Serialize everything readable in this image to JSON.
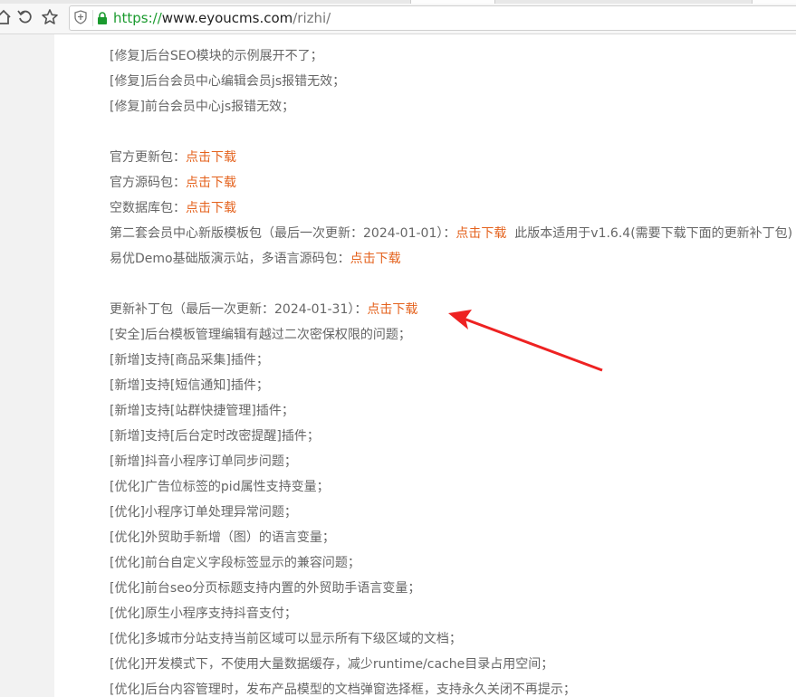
{
  "browser": {
    "url_scheme": "https://",
    "url_host": "www.eyoucms.com",
    "url_path": "/rizhi/"
  },
  "download_label": "点击下载",
  "log_lines_top": [
    "[修复]后台SEO模块的示例展开不了；",
    "[修复]后台会员中心编辑会员js报错无效；",
    "[修复]前台会员中心js报错无效；"
  ],
  "packages": {
    "official_update": "官方更新包：",
    "official_source": "官方源码包：",
    "empty_db": "空数据库包：",
    "member_template": "第二套会员中心新版模板包（最后一次更新：2024-01-01）：",
    "member_template_note": "此版本适用于v1.6.4(需要下载下面的更新补丁包)",
    "demo": "易优Demo基础版演示站，多语言源码包："
  },
  "patch": {
    "title": "更新补丁包（最后一次更新：2024-01-31）："
  },
  "changelog": [
    "[安全]后台模板管理编辑有越过二次密保权限的问题；",
    "[新增]支持[商品采集]插件；",
    "[新增]支持[短信通知]插件；",
    "[新增]支持[站群快捷管理]插件；",
    "[新增]支持[后台定时改密提醒]插件；",
    "[新增]抖音小程序订单同步问题；",
    "[优化]广告位标签的pid属性支持变量；",
    "[优化]小程序订单处理异常问题；",
    "[优化]外贸助手新增（图）的语言变量；",
    "[优化]前台自定义字段标签显示的兼容问题；",
    "[优化]前台seo分页标题支持内置的外贸助手语言变量；",
    "[优化]原生小程序支持抖音支付；",
    "[优化]多城市分站支持当前区域可以显示所有下级区域的文档；",
    "[优化]开发模式下，不使用大量数据缓存，减少runtime/cache目录占用空间；",
    "[优化]后台内容管理时，发布产品模型的文档弹窗选择框，支持永久关闭不再提示；"
  ]
}
